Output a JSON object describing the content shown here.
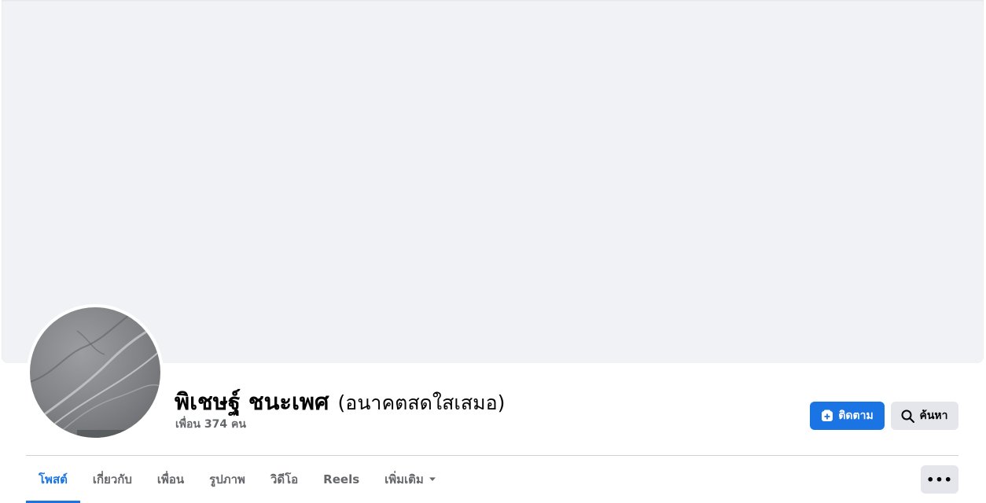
{
  "profile": {
    "name": "พิเชษฐ์ ชนะเพศ",
    "alternate_name": "(อนาคตสดใสเสมอ)",
    "friends_count": "เพื่อน 374 คน"
  },
  "actions": {
    "follow_label": "ติดตาม",
    "search_label": "ค้นหา",
    "more_label": "•••"
  },
  "tabs": [
    {
      "label": "โพสต์",
      "active": true
    },
    {
      "label": "เกี่ยวกับ"
    },
    {
      "label": "เพื่อน"
    },
    {
      "label": "รูปภาพ"
    },
    {
      "label": "วิดีโอ"
    },
    {
      "label": "Reels"
    },
    {
      "label": "เพิ่มเติม"
    }
  ],
  "icons": {
    "follow": "follow-plus-icon",
    "search": "search-icon",
    "more_caret": "caret-down-icon",
    "more": "more-options-icon"
  },
  "colors": {
    "accent": "#1b74e4",
    "cover_bg": "#f0f2f5",
    "secondary_btn": "#e4e6eb",
    "muted_text": "#65676b"
  }
}
